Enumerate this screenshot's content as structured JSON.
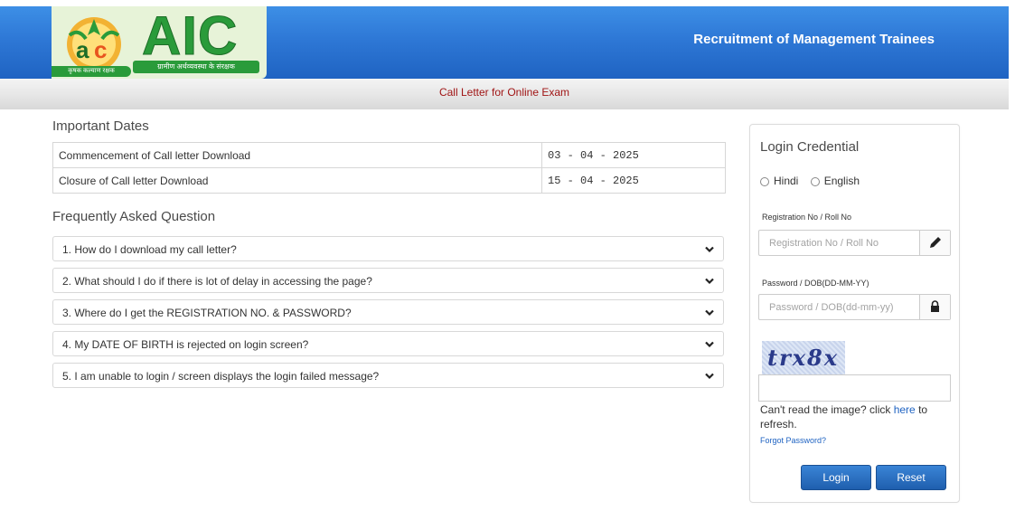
{
  "brand": {
    "logo_text": "AIC",
    "logo_strap_hindi": "ग्रामीण अर्थव्यवस्था के संरक्षक",
    "logo_tagline_hindi": "कृषक कल्याण रक्षक",
    "site_title": "Recruitment of Management Trainees",
    "brand_color": "#2a9b3a",
    "header_color": "#2e78d6"
  },
  "subbar": {
    "title": "Call Letter for Online Exam",
    "title_color": "#a01515"
  },
  "important_dates": {
    "heading": "Important Dates",
    "rows": [
      {
        "label": "Commencement of Call letter Download",
        "value": "03 - 04 - 2025"
      },
      {
        "label": "Closure of Call letter Download",
        "value": "15 - 04 - 2025"
      }
    ]
  },
  "faq": {
    "heading": "Frequently Asked Question",
    "items": [
      "1. How do I download my call letter?",
      "2. What should I do if there is lot of delay in accessing the page?",
      "3. Where do I get the REGISTRATION NO. & PASSWORD?",
      "4. My DATE OF BIRTH is rejected on login screen?",
      "5. I am unable to login / screen displays the login failed message?"
    ],
    "expand_icon": "chevron-down-icon"
  },
  "login": {
    "heading": "Login Credential",
    "languages": [
      "Hindi",
      "English"
    ],
    "reg_label": "Registration No / Roll No",
    "reg_placeholder": "Registration No / Roll No",
    "reg_icon": "pencil-icon",
    "pwd_label": "Password / DOB(DD-MM-YY)",
    "pwd_placeholder": "Password / DOB(dd-mm-yy)",
    "pwd_icon": "lock-icon",
    "captcha_text": "trx8x",
    "help_prefix": "Can't read the image? click ",
    "help_link": "here",
    "help_suffix": " to refresh.",
    "forgot": "Forgot Password?",
    "login_button": "Login",
    "reset_button": "Reset"
  }
}
